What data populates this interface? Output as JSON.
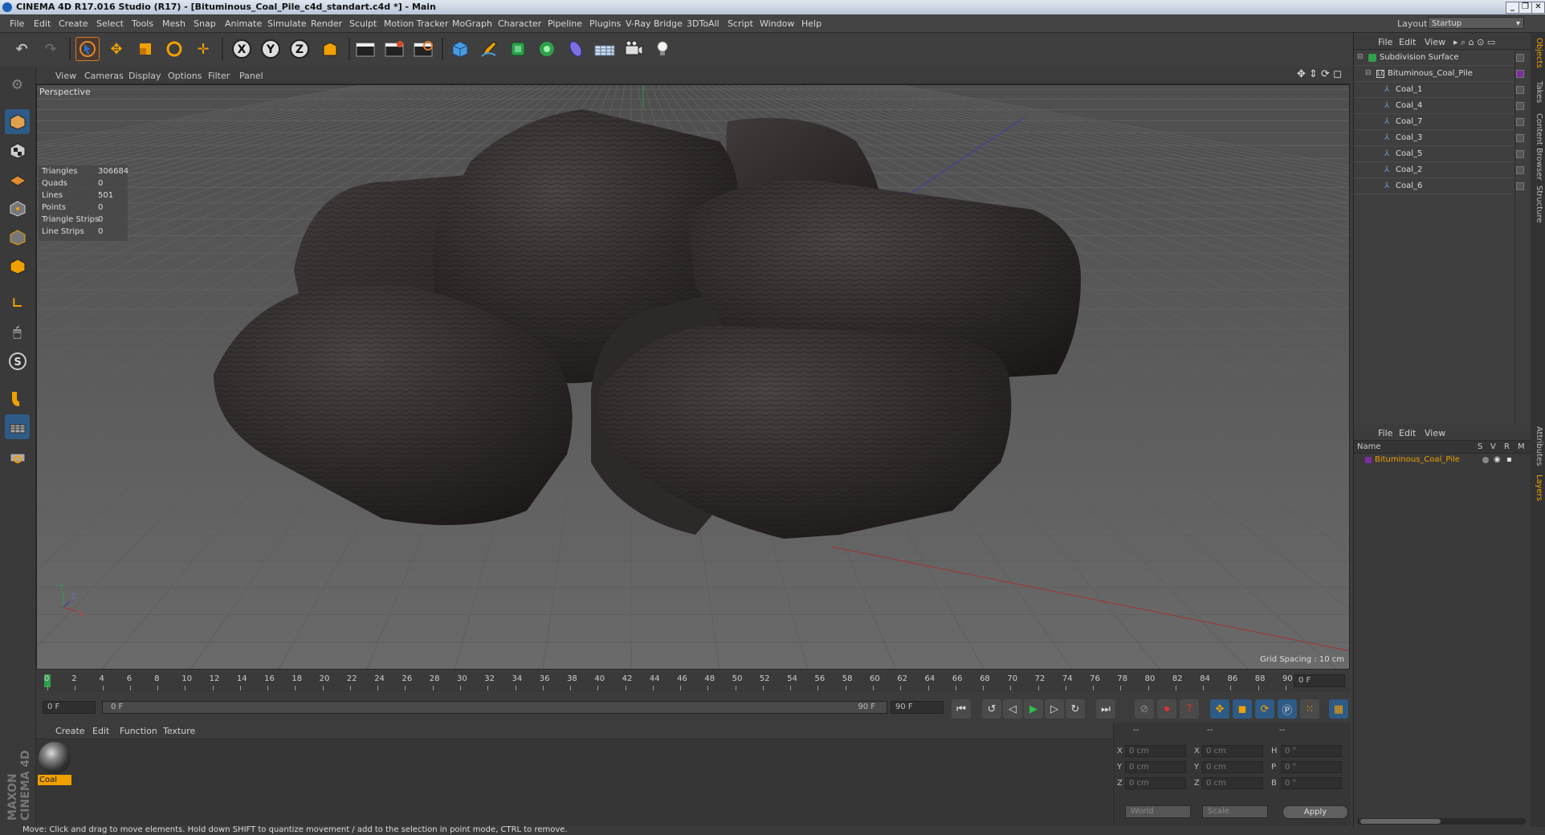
{
  "window": {
    "title": "CINEMA 4D R17.016 Studio (R17) - [Bituminous_Coal_Pile_c4d_standart.c4d *] - Main",
    "controls": [
      "_",
      "❐",
      "✕"
    ]
  },
  "menu": [
    "File",
    "Edit",
    "Create",
    "Select",
    "Tools",
    "Mesh",
    "Snap",
    "Animate",
    "Simulate",
    "Render",
    "Sculpt",
    "Motion Tracker",
    "MoGraph",
    "Character",
    "Pipeline",
    "Plugins",
    "V-Ray Bridge",
    "3DToAll",
    "Script",
    "Window",
    "Help"
  ],
  "layout": {
    "label": "Layout:",
    "value": "Startup"
  },
  "toolbar": {
    "icons": [
      "undo-icon",
      "redo-icon",
      "select-arrow-icon",
      "move-icon",
      "scale-icon",
      "rotate-icon",
      "transform-icon",
      "x-axis-icon",
      "y-axis-icon",
      "z-axis-icon",
      "coordinate-system-icon",
      "render-view-icon",
      "render-picture-viewer-icon",
      "render-settings-icon",
      "cube-icon",
      "pen-icon",
      "subdivision-icon",
      "cloner-icon",
      "deformer-icon",
      "floor-icon",
      "camera-icon",
      "light-icon"
    ],
    "axis_labels": [
      "X",
      "Y",
      "Z"
    ]
  },
  "viewport": {
    "menu": [
      "View",
      "Cameras",
      "Display",
      "Options",
      "Filter",
      "Panel"
    ],
    "camera": "Perspective",
    "stats": [
      {
        "label": "Triangles",
        "value": "306684"
      },
      {
        "label": "Quads",
        "value": "0"
      },
      {
        "label": "Lines",
        "value": "501"
      },
      {
        "label": "Points",
        "value": "0"
      },
      {
        "label": "Triangle Strips",
        "value": "0"
      },
      {
        "label": "Line Strips",
        "value": "0"
      }
    ],
    "grid_spacing": "Grid Spacing : 10 cm",
    "axis_labels": [
      "Y",
      "Z",
      "X"
    ]
  },
  "timeline": {
    "ticks": [
      "0",
      "2",
      "4",
      "6",
      "8",
      "10",
      "12",
      "14",
      "16",
      "18",
      "20",
      "22",
      "24",
      "26",
      "28",
      "30",
      "32",
      "34",
      "36",
      "38",
      "40",
      "42",
      "44",
      "46",
      "48",
      "50",
      "52",
      "54",
      "56",
      "58",
      "60",
      "62",
      "64",
      "66",
      "68",
      "70",
      "72",
      "74",
      "76",
      "78",
      "80",
      "82",
      "84",
      "86",
      "88",
      "90"
    ],
    "current_frame": "0 F",
    "start_field": "0 F",
    "range_start": "0 F",
    "range_end": "90 F",
    "end_field": "90 F"
  },
  "material_manager": {
    "menu": [
      "Create",
      "Edit",
      "Function",
      "Texture"
    ],
    "materials": [
      {
        "name": "Coal"
      }
    ]
  },
  "coordinates": {
    "headers": [
      "--",
      "--",
      "--"
    ],
    "rows": [
      {
        "a": "X",
        "v1": "0 cm",
        "b": "X",
        "v2": "0 cm",
        "c": "H",
        "v3": "0 °"
      },
      {
        "a": "Y",
        "v1": "0 cm",
        "b": "Y",
        "v2": "0 cm",
        "c": "P",
        "v3": "0 °"
      },
      {
        "a": "Z",
        "v1": "0 cm",
        "b": "Z",
        "v2": "0 cm",
        "c": "B",
        "v3": "0 °"
      }
    ],
    "world": "World",
    "scale": "Scale",
    "apply": "Apply"
  },
  "status": "Move: Click and drag to move elements. Hold down SHIFT to quantize movement / add to the selection in point mode, CTRL to remove.",
  "object_manager": {
    "menu": [
      "File",
      "Edit",
      "View"
    ],
    "objects": [
      {
        "name": "Subdivision Surface",
        "depth": 0
      },
      {
        "name": "Bituminous_Coal_Pile",
        "depth": 1
      },
      {
        "name": "Coal_1",
        "depth": 2
      },
      {
        "name": "Coal_4",
        "depth": 2
      },
      {
        "name": "Coal_7",
        "depth": 2
      },
      {
        "name": "Coal_3",
        "depth": 2
      },
      {
        "name": "Coal_5",
        "depth": 2
      },
      {
        "name": "Coal_2",
        "depth": 2
      },
      {
        "name": "Coal_6",
        "depth": 2
      }
    ]
  },
  "layer_manager": {
    "menu": [
      "File",
      "Edit",
      "View"
    ],
    "columns": [
      "Name",
      "S",
      "V",
      "R",
      "M"
    ],
    "layers": [
      {
        "name": "Bituminous_Coal_Pile",
        "color": "#7a2ea0"
      }
    ]
  },
  "side_tabs": [
    "Objects",
    "Takes",
    "Content Browser",
    "Structure",
    "Attributes",
    "Layers"
  ],
  "brand": "MAXON CINEMA 4D",
  "colors": {
    "accent": "#f0a000",
    "coal": "#2b2626",
    "grid": "#5e5e5e"
  }
}
